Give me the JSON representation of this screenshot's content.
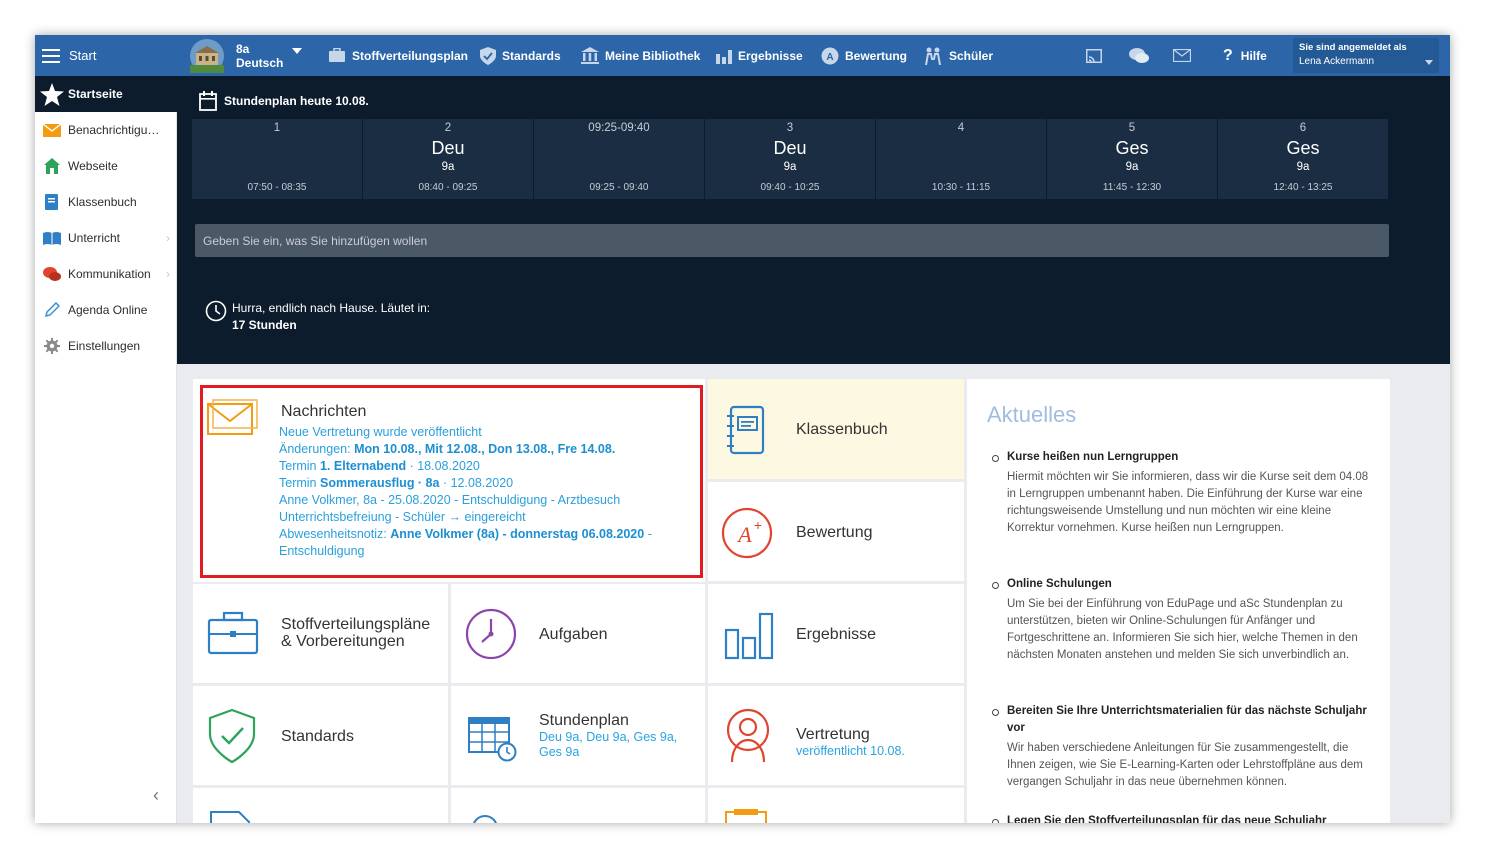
{
  "topbar": {
    "start_label": "Start",
    "class_name": "8a",
    "subject_name": "Deutsch",
    "nav": [
      "Stoffverteilungsplan",
      "Standards",
      "Meine Bibliothek",
      "Ergebnisse",
      "Bewertung",
      "Schüler"
    ],
    "help_label": "Hilfe",
    "login_label": "Sie sind angemeldet als",
    "user_name": "Lena Ackermann"
  },
  "sidebar": {
    "active": "Startseite",
    "items": [
      "Benachrichtigu…",
      "Webseite",
      "Klassenbuch",
      "Unterricht",
      "Kommunikation",
      "Agenda Online",
      "Einstellungen"
    ]
  },
  "timetable": {
    "title": "Stundenplan heute 10.08.",
    "cells": [
      {
        "period": "1",
        "subject": "",
        "class": "",
        "time": "07:50 - 08:35"
      },
      {
        "period": "2",
        "subject": "Deu",
        "class": "9a",
        "time": "08:40 - 09:25"
      },
      {
        "period": "09:25-09:40",
        "subject": "",
        "class": "",
        "time": "09:25 - 09:40"
      },
      {
        "period": "3",
        "subject": "Deu",
        "class": "9a",
        "time": "09:40 - 10:25"
      },
      {
        "period": "4",
        "subject": "",
        "class": "",
        "time": "10:30 - 11:15"
      },
      {
        "period": "5",
        "subject": "Ges",
        "class": "9a",
        "time": "11:45 - 12:30"
      },
      {
        "period": "6",
        "subject": "Ges",
        "class": "9a",
        "time": "12:40 - 13:25"
      }
    ],
    "input_placeholder": "Geben Sie ein, was Sie hinzufügen wollen",
    "home_text": "Hurra, endlich nach Hause. Läutet in:",
    "home_value": "17 Stunden"
  },
  "tiles": {
    "nachrichten": {
      "label": "Nachrichten",
      "m1": "Neue Vertretung wurde veröffentlicht",
      "m2a": "Änderungen: ",
      "m2b": "Mon 10.08., Mit 12.08., Don 13.08., Fre 14.08.",
      "m3a": "Termin ",
      "m3b": "1. Elternabend",
      "m3c": " · 18.08.2020",
      "m4a": "Termin ",
      "m4b": "Sommerausflug · 8a",
      "m4c": " · 12.08.2020",
      "m5": "Anne Volkmer, 8a - 25.08.2020 - Entschuldigung - Arztbesuch",
      "m6": "Unterrichtsbefreiung - Schüler → eingereicht",
      "m7a": "Abwesenheitsnotiz: ",
      "m7b": "Anne Volkmer (8a) - donnerstag 06.08.2020",
      "m7c": " -",
      "m8": "Entschuldigung"
    },
    "klassenbuch": "Klassenbuch",
    "bewertung": "Bewertung",
    "stoff_1": "Stoffverteilungspläne",
    "stoff_2": "& Vorbereitungen",
    "aufgaben": "Aufgaben",
    "ergebnisse": "Ergebnisse",
    "standards": "Standards",
    "stundenplan": "Stundenplan",
    "stundenplan_sub_1": "Deu 9a, Deu 9a, Ges 9a,",
    "stundenplan_sub_2": "Ges 9a",
    "vertretung": "Vertretung",
    "vertretung_sub": "veröffentlicht 10.08."
  },
  "aktuelles": {
    "title": "Aktuelles",
    "news": [
      {
        "heading": "Kurse heißen nun Lerngruppen",
        "body": "Hiermit möchten wir Sie informieren, dass wir die Kurse seit dem 04.08 in Lerngruppen umbenannt haben. Die Einführung der Kurse war eine richtungsweisende Umstellung und nun möchten wir eine kleine Korrektur vornehmen. Kurse heißen nun Lerngruppen."
      },
      {
        "heading": "Online Schulungen",
        "body": "Um Sie bei der Einführung von EduPage und aSc Stundenplan zu unterstützen, bieten wir Online-Schulungen für Anfänger und Fortgeschrittene an. Informieren Sie sich hier, welche Themen in den nächsten Monaten anstehen und melden Sie sich unverbindlich an."
      },
      {
        "heading": "Bereiten Sie Ihre Unterrichtsmaterialien für das nächste Schuljahr vor",
        "body": "Wir haben verschiedene Anleitungen für Sie zusammengestellt, die Ihnen zeigen, wie Sie E-Learning-Karten oder Lehrstoffpläne aus dem vergangen Schuljahr in das neue übernehmen können."
      },
      {
        "heading": "Legen Sie den Stoffverteilungsplan für das neue Schuljahr",
        "body": ""
      }
    ]
  },
  "colors": {
    "topbar": "#2c66a8",
    "dark": "#0c1c2d",
    "accent": "#29a3e0",
    "highlight": "#e21b23"
  }
}
